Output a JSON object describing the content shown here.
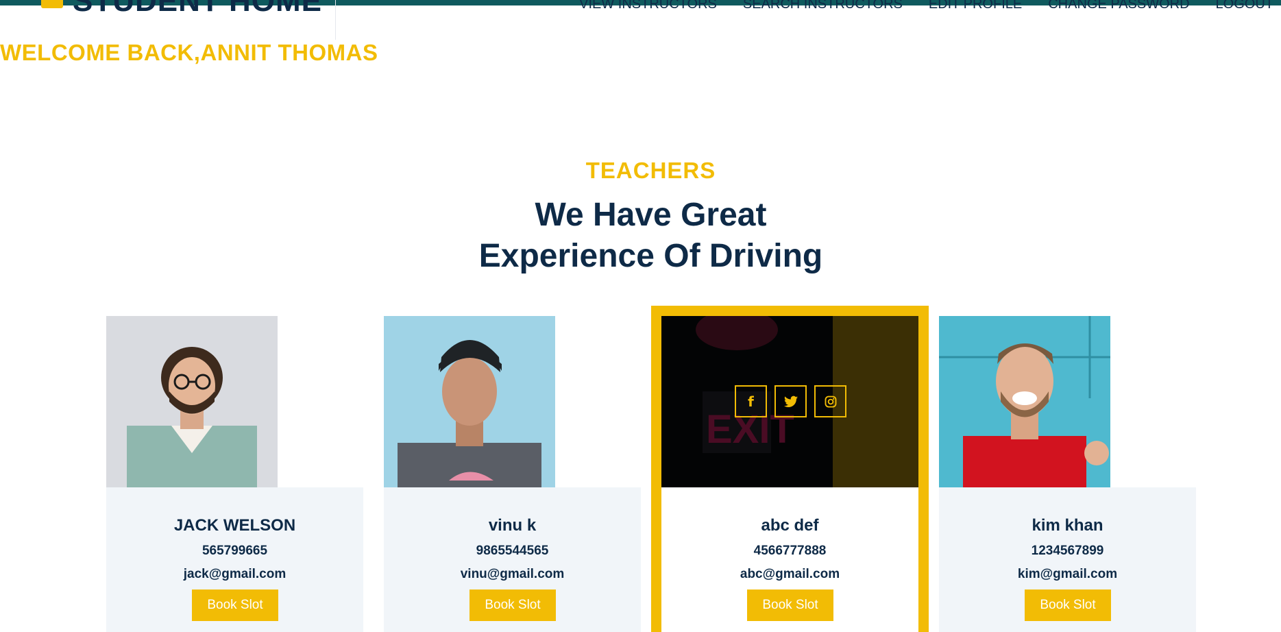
{
  "header": {
    "brand": "STUDENT HOME",
    "nav": [
      "VIEW INSTRUCTORS",
      "SEARCH INSTRUCTORS",
      "EDIT PROFILE",
      "CHANGE PASSWORD",
      "LOGOUT"
    ]
  },
  "welcome": "WELCOME BACK,ANNIT THOMAS",
  "section": {
    "tag": "TEACHERS",
    "title_line1": "We Have Great",
    "title_line2": "Experience Of Driving"
  },
  "teachers": [
    {
      "name": "JACK WELSON",
      "phone": "565799665",
      "email": "jack@gmail.com",
      "button": "Book Slot"
    },
    {
      "name": "vinu k",
      "phone": "9865544565",
      "email": "vinu@gmail.com",
      "button": "Book Slot"
    },
    {
      "name": "abc def",
      "phone": "4566777888",
      "email": "abc@gmail.com",
      "button": "Book Slot"
    },
    {
      "name": "kim khan",
      "phone": "1234567899",
      "email": "kim@gmail.com",
      "button": "Book Slot"
    }
  ],
  "icons": {
    "brand": "car-icon",
    "social": [
      "facebook-icon",
      "twitter-icon",
      "instagram-icon"
    ]
  },
  "colors": {
    "accent": "#f2bc05",
    "navy": "#0e2a47",
    "topbar": "#0f5a5e",
    "card_bg": "#f1f5f9"
  }
}
